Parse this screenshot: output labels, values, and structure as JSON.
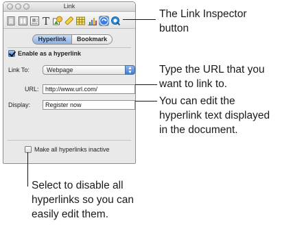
{
  "window": {
    "title": "Link"
  },
  "toolbar": {
    "icons": [
      "document-icon",
      "layout-icon",
      "wrap-icon",
      "text-icon",
      "graphic-icon",
      "metrics-icon",
      "table-icon",
      "chart-icon",
      "link-icon",
      "quicktime-icon"
    ]
  },
  "tabs": [
    {
      "label": "Hyperlink",
      "selected": true
    },
    {
      "label": "Bookmark",
      "selected": false
    }
  ],
  "form": {
    "enable_label": "Enable as a hyperlink",
    "enable_checked": true,
    "link_to_label": "Link To:",
    "link_to_value": "Webpage",
    "url_label": "URL:",
    "url_value": "http://www.url.com/",
    "display_label": "Display:",
    "display_value": "Register now",
    "inactive_label": "Make all hyperlinks inactive",
    "inactive_checked": false
  },
  "callouts": {
    "inspector_button": [
      "The Link Inspector",
      "button"
    ],
    "url": [
      "Type the URL that you",
      "want to link to."
    ],
    "display": [
      "You can edit the",
      "hyperlink text displayed",
      "in the document."
    ],
    "inactive": [
      "Select to disable all",
      "hyperlinks so you can",
      "easily edit them."
    ]
  }
}
